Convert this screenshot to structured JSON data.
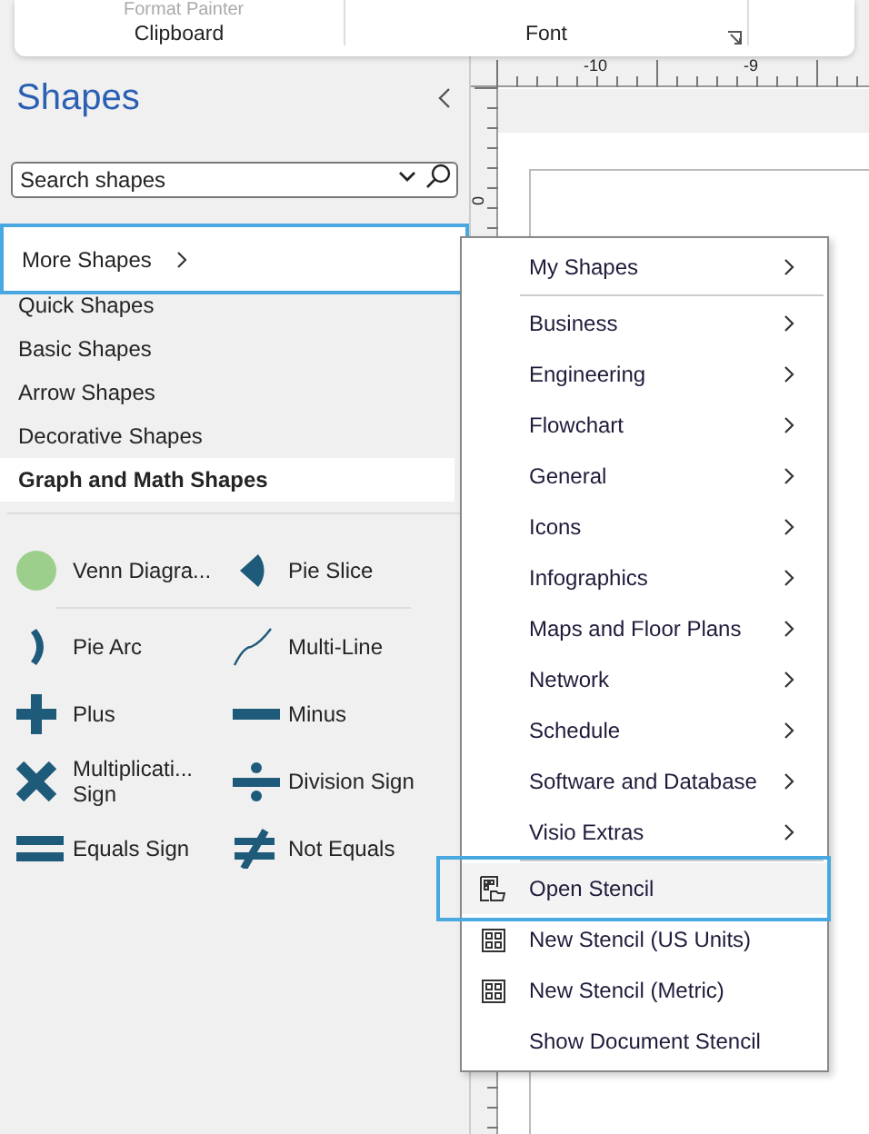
{
  "ribbon": {
    "partial_button": "Format Painter",
    "groups": [
      {
        "label": "Clipboard",
        "launcher": false
      },
      {
        "label": "Font",
        "launcher": true
      }
    ]
  },
  "shapes_panel": {
    "title": "Shapes",
    "search": {
      "placeholder": "Search shapes"
    },
    "more_shapes": {
      "label": "More Shapes",
      "highlighted": true
    },
    "categories": [
      {
        "label": "Quick Shapes",
        "selected": false
      },
      {
        "label": "Basic Shapes",
        "selected": false
      },
      {
        "label": "Arrow Shapes",
        "selected": false
      },
      {
        "label": "Decorative Shapes",
        "selected": false
      },
      {
        "label": "Graph and Math Shapes",
        "selected": true
      }
    ],
    "shapes": [
      {
        "label": "Venn Diagra...",
        "kind": "venn"
      },
      {
        "label": "Pie Slice",
        "kind": "pie-slice"
      },
      {
        "label": "Pie Arc",
        "kind": "pie-arc"
      },
      {
        "label": "Multi-Line",
        "kind": "multi-line"
      },
      {
        "label": "Plus",
        "kind": "plus"
      },
      {
        "label": "Minus",
        "kind": "minus"
      },
      {
        "label": "Multiplicati... Sign",
        "kind": "multiply"
      },
      {
        "label": "Division Sign",
        "kind": "divide"
      },
      {
        "label": "Equals Sign",
        "kind": "equals"
      },
      {
        "label": "Not Equals",
        "kind": "not-equals"
      }
    ]
  },
  "ruler": {
    "labels": [
      "-10",
      "-9"
    ],
    "vertical_label": "0"
  },
  "menu": {
    "items": [
      {
        "label": "My Shapes",
        "kind": "submenu",
        "highlighted": false
      },
      {
        "label": "Business",
        "kind": "submenu",
        "highlighted": false
      },
      {
        "label": "Engineering",
        "kind": "submenu",
        "highlighted": false
      },
      {
        "label": "Flowchart",
        "kind": "submenu",
        "highlighted": false
      },
      {
        "label": "General",
        "kind": "submenu",
        "highlighted": false
      },
      {
        "label": "Icons",
        "kind": "submenu",
        "highlighted": false
      },
      {
        "label": "Infographics",
        "kind": "submenu",
        "highlighted": false
      },
      {
        "label": "Maps and Floor Plans",
        "kind": "submenu",
        "highlighted": false
      },
      {
        "label": "Network",
        "kind": "submenu",
        "highlighted": false
      },
      {
        "label": "Schedule",
        "kind": "submenu",
        "highlighted": false
      },
      {
        "label": "Software and Database",
        "kind": "submenu",
        "highlighted": false
      },
      {
        "label": "Visio Extras",
        "kind": "submenu",
        "highlighted": false
      },
      {
        "label": "Open Stencil",
        "kind": "open-stencil",
        "highlighted": true
      },
      {
        "label": "New Stencil (US Units)",
        "kind": "new-stencil",
        "highlighted": false
      },
      {
        "label": "New Stencil (Metric)",
        "kind": "new-stencil",
        "highlighted": false
      },
      {
        "label": "Show Document Stencil",
        "kind": "command",
        "highlighted": false
      }
    ]
  }
}
